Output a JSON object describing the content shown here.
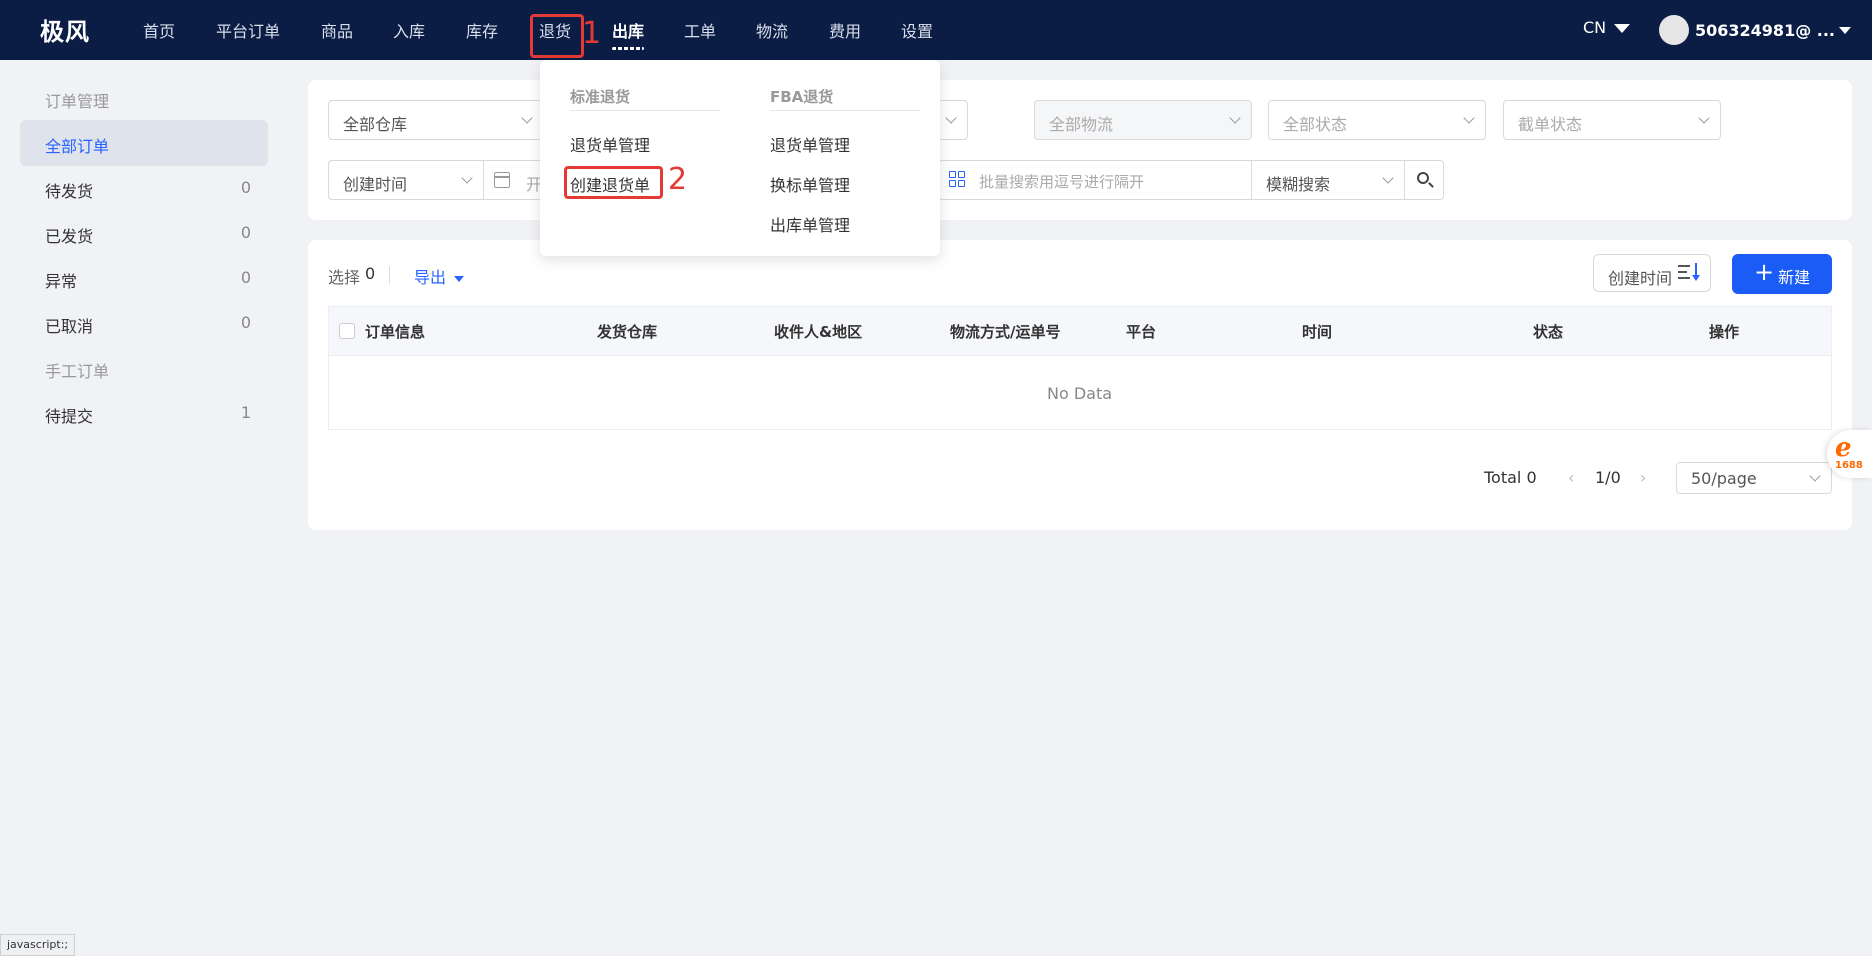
{
  "app": {
    "logo": "极风"
  },
  "nav": {
    "items": [
      "首页",
      "平台订单",
      "商品",
      "入库",
      "库存",
      "退货",
      "出库",
      "工单",
      "物流",
      "费用",
      "设置"
    ],
    "active": "出库"
  },
  "annotations": {
    "step1": "1",
    "step2": "2"
  },
  "header": {
    "lang": "CN",
    "user": "506324981@ ..."
  },
  "sidebar": {
    "group1": "订单管理",
    "items": [
      {
        "label": "全部订单",
        "count": ""
      },
      {
        "label": "待发货",
        "count": "0"
      },
      {
        "label": "已发货",
        "count": "0"
      },
      {
        "label": "异常",
        "count": "0"
      },
      {
        "label": "已取消",
        "count": "0"
      }
    ],
    "group2": "手工订单",
    "manual_items": [
      {
        "label": "待提交",
        "count": "1"
      }
    ]
  },
  "filters": {
    "warehouse": "全部仓库",
    "logistics": "全部物流",
    "status": "全部状态",
    "cutoff": "截单状态",
    "time_type": "创建时间",
    "date_placeholder": "开",
    "batch_placeholder": "批量搜索用逗号进行隔开",
    "search_mode": "模糊搜索"
  },
  "dropdown": {
    "standard": {
      "title": "标准退货",
      "items": [
        "退货单管理",
        "创建退货单"
      ]
    },
    "fba": {
      "title": "FBA退货",
      "items": [
        "退货单管理",
        "换标单管理",
        "出库单管理"
      ]
    }
  },
  "toolbar": {
    "selected_label": "选择",
    "selected_count": "0",
    "export": "导出",
    "sort_label": "创建时间",
    "new_button": "新建"
  },
  "table": {
    "columns": [
      "订单信息",
      "发货仓库",
      "收件人&地区",
      "物流方式/运单号",
      "平台",
      "时间",
      "状态",
      "操作"
    ],
    "empty": "No Data"
  },
  "pager": {
    "total": "Total 0",
    "page": "1/0",
    "page_size": "50/page"
  },
  "badge": {
    "text": "1688"
  },
  "statusbar": {
    "text": "javascript:;"
  },
  "colors": {
    "topbar": "#0b1d45",
    "accent": "#1a5cf5",
    "annotation": "#e53935"
  }
}
